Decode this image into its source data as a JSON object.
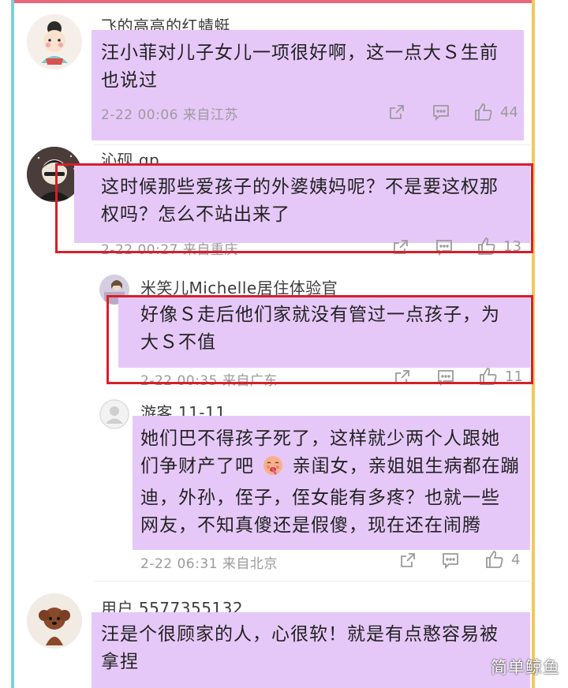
{
  "comments": [
    {
      "username": "飞的高高的红蜻蜓",
      "text_lines": [
        "汪小菲对儿子女儿一项很好啊，这一点大Ｓ生前",
        "也说过"
      ],
      "meta": "2-22 00:06 来自江苏",
      "likes": "44"
    },
    {
      "username": "沁砚 qp",
      "text_lines": [
        "这时候那些爱孩子的外婆姨妈呢？不是要这权那",
        "权吗？怎么不站出来了"
      ],
      "meta": "2-22 00:27 来自重庆",
      "likes": "13"
    },
    {
      "username": "米笑儿Michelle居住体验官",
      "text_lines": [
        "好像Ｓ走后他们家就没有管过一点孩子，为",
        "大Ｓ不值"
      ],
      "meta": "2-22 00:35 来自广东",
      "likes": "11"
    },
    {
      "username": "游客 11-11",
      "text_lines": [
        "她们巴不得孩子死了，这样就少两个人跟她",
        "们争财产了吧",
        "亲闺女，亲姐姐生病都在蹦",
        "迪，外孙，侄子，侄女能有多疼？也就一些",
        "网友，不知真傻还是假傻，现在还在闹腾"
      ],
      "meta": "2-22 06:31 来自北京",
      "likes": "4"
    },
    {
      "username": "用户 5577355132",
      "text_lines": [
        "汪是个很顾家的人，心很软！就是有点憨容易被",
        "拿捏"
      ],
      "meta": "",
      "likes": ""
    }
  ],
  "icons": [
    "share-icon",
    "comment-icon",
    "thumbs-up-icon",
    "emoji-icon"
  ],
  "watermark": "简单鲸鱼",
  "colors": {
    "highlight": "#e6c8f8",
    "red_box": "#d61f2a",
    "meta": "#9b9b9b"
  }
}
